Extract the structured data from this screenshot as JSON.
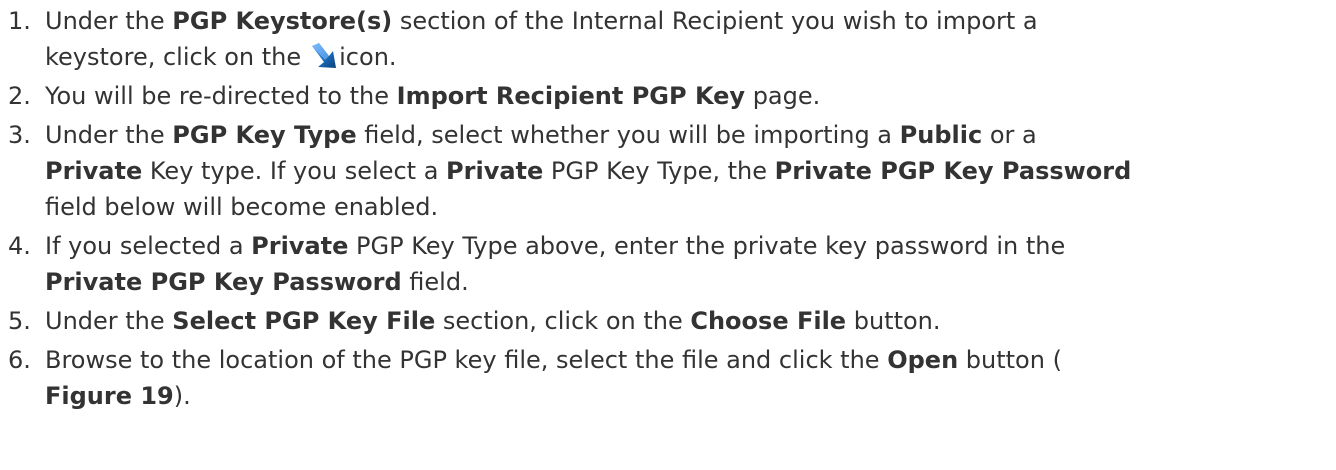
{
  "colors": {
    "text": "#333333",
    "icon_blue": "#1e73c8",
    "icon_dark": "#0b3f7a"
  },
  "steps": [
    {
      "number": "1.",
      "line1": {
        "t1": "Under the ",
        "b1": "PGP Keystore(s)",
        "t2": " section of the Internal Recipient you wish to import a"
      },
      "line2": {
        "t1": "keystore, click on the",
        "icon_name": "import-arrow-icon",
        "t2": "icon."
      }
    },
    {
      "number": "2.",
      "t1": "You will be re-directed to the ",
      "b1": "Import Recipient PGP Key",
      "t2": " page."
    },
    {
      "number": "3.",
      "line1": {
        "t1": "Under the ",
        "b1": "PGP Key Type",
        "t2": " field, select whether you will be importing a ",
        "b2": "Public",
        "t3": " or a"
      },
      "line2": {
        "b1": "Private",
        "t1": " Key type. If you select a ",
        "b2": "Private",
        "t2": " PGP Key Type, the ",
        "b3": "Private PGP Key Password"
      },
      "line3": {
        "t1": " field below will become enabled."
      }
    },
    {
      "number": "4.",
      "line1": {
        "t1": "If you selected a ",
        "b1": "Private",
        "t2": " PGP Key Type above, enter the private key password in the"
      },
      "line2": {
        "b1": "Private PGP Key Password",
        "t1": " field."
      }
    },
    {
      "number": "5.",
      "t1": "Under the ",
      "b1": "Select PGP Key File",
      "t2": " section, click on the ",
      "b2": "Choose File",
      "t3": " button."
    },
    {
      "number": "6.",
      "line1": {
        "t1": "Browse to the location of the PGP key file, select the file and click the ",
        "b1": "Open",
        "t2": " button ("
      },
      "line2": {
        "b1": "Figure 19",
        "t1": ")."
      }
    }
  ]
}
